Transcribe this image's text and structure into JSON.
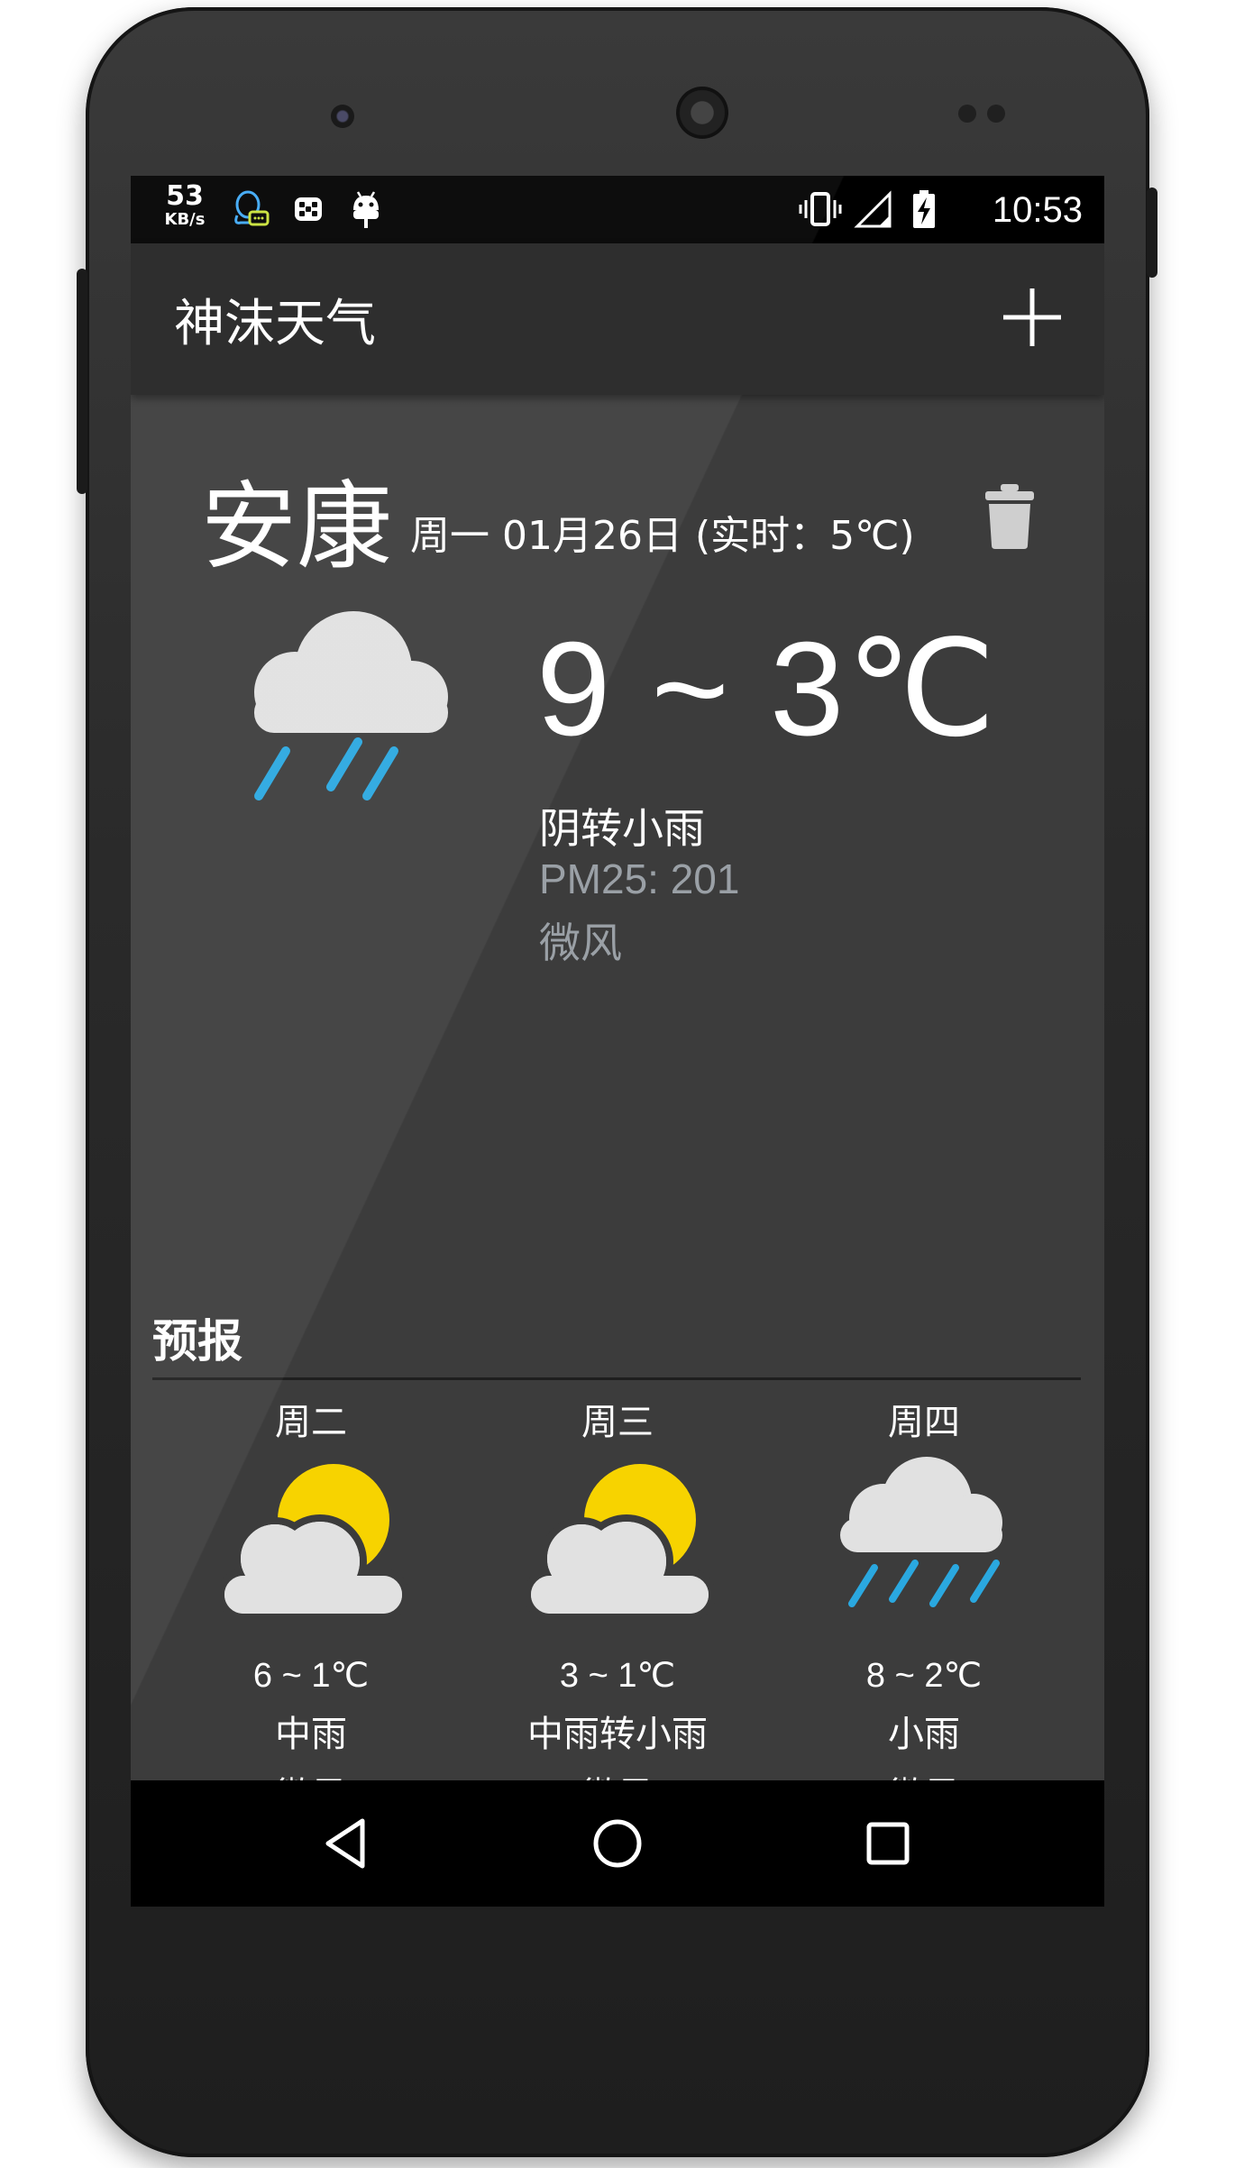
{
  "status_bar": {
    "net_speed_value": "53",
    "net_speed_unit": "KB/s",
    "time": "10:53",
    "icons": [
      "qq-icon",
      "slack-icon",
      "android-icon",
      "vibrate-icon",
      "signal-icon",
      "battery-charging-icon"
    ]
  },
  "app_bar": {
    "title": "神沫天气",
    "add_icon": "plus-icon"
  },
  "current": {
    "city": "安康",
    "date_line": "周一 01月26日 (实时：5℃)",
    "icon": "cloud-rain-icon",
    "temp_range": "9 ~ 3℃",
    "condition": "阴转小雨",
    "pm25": "PM25: 201",
    "wind": "微风"
  },
  "forecast": {
    "title": "预报",
    "days": [
      {
        "day": "周二",
        "icon": "partly-cloudy-icon",
        "temp": "6 ~ 1℃",
        "condition": "中雨",
        "wind": "微风"
      },
      {
        "day": "周三",
        "icon": "partly-cloudy-icon",
        "temp": "3 ~ 1℃",
        "condition": "中雨转小雨",
        "wind": "微风"
      },
      {
        "day": "周四",
        "icon": "cloud-rain-icon",
        "temp": "8 ~ 2℃",
        "condition": "小雨",
        "wind": "微风"
      }
    ]
  },
  "nav_bar": {
    "icons": [
      "back-icon",
      "home-icon",
      "recents-icon"
    ]
  },
  "colors": {
    "sun": "#f7d300",
    "cloud": "#e1e1e1",
    "rain": "#2aa8e0",
    "background": "#3c3c3c",
    "app_bar": "#2e2e2e",
    "secondary_text": "#9aa0a6"
  }
}
